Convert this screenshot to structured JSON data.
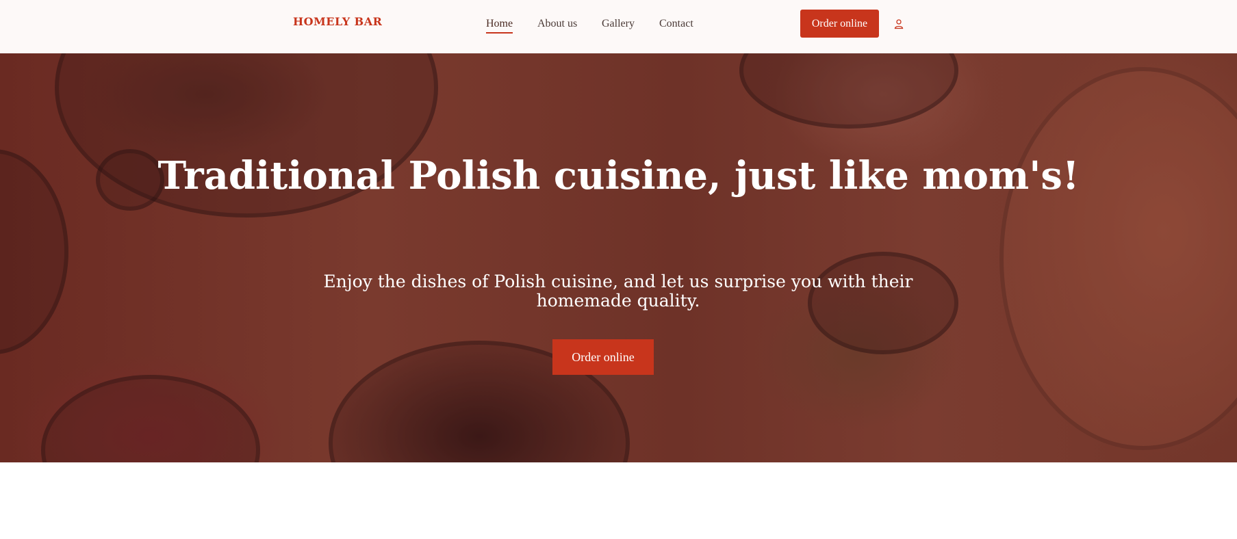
{
  "brand": {
    "name": "HOMELY BAR"
  },
  "nav": {
    "items": [
      {
        "label": "Home",
        "active": true
      },
      {
        "label": "About us",
        "active": false
      },
      {
        "label": "Gallery",
        "active": false
      },
      {
        "label": "Contact",
        "active": false
      }
    ]
  },
  "header": {
    "order_label": "Order online",
    "account_icon": "user-icon"
  },
  "hero": {
    "title": "Traditional Polish cuisine, just like mom's!",
    "subtitle": "Enjoy the dishes of Polish cuisine, and let us surprise you with their homemade quality.",
    "order_label": "Order online"
  },
  "colors": {
    "accent": "#c8351c",
    "header_bg": "#fdf9f8",
    "hero_overlay": "#6e2e26"
  }
}
